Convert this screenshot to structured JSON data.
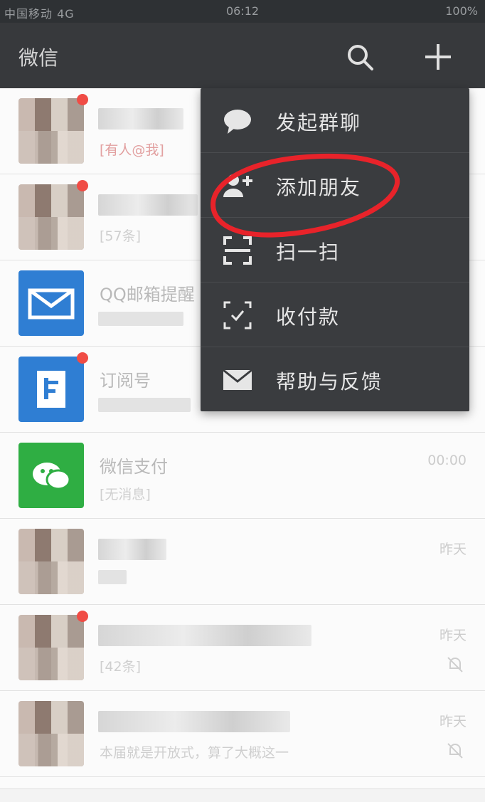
{
  "status_bar": {
    "left": "中国移动 4G",
    "time": "06:12",
    "right": "100%"
  },
  "header": {
    "title": "微信",
    "search_icon": "search-icon",
    "add_icon": "plus-icon"
  },
  "menu": {
    "items": [
      {
        "label": "发起群聊",
        "icon": "chat-bubble-icon"
      },
      {
        "label": "添加朋友",
        "icon": "add-friend-icon"
      },
      {
        "label": "扫一扫",
        "icon": "scan-icon"
      },
      {
        "label": "收付款",
        "icon": "pay-scan-icon"
      },
      {
        "label": "帮助与反馈",
        "icon": "mail-icon"
      }
    ]
  },
  "chats": [
    {
      "name": "",
      "message": "[有人@我]",
      "time": "",
      "muted": false
    },
    {
      "name": "",
      "message": "[57条]",
      "time": "",
      "muted": false
    },
    {
      "name": "QQ邮箱提醒",
      "message": "",
      "time": "",
      "muted": false
    },
    {
      "name": "订阅号",
      "message": "",
      "time": "",
      "muted": false
    },
    {
      "name": "微信支付",
      "message": "[无消息]",
      "time": "00:00",
      "muted": false
    },
    {
      "name": "",
      "message": "",
      "time": "昨天",
      "muted": false
    },
    {
      "name": "",
      "message": "[42条]",
      "time": "昨天",
      "muted": true
    },
    {
      "name": "",
      "message": "本届就是开放式，算了大概这一",
      "time": "昨天",
      "muted": true
    }
  ],
  "colors": {
    "header_bg": "#37393c",
    "menu_bg": "#3a3c3f",
    "annotation_red": "#e8232a",
    "badge_red": "#f04c45"
  }
}
